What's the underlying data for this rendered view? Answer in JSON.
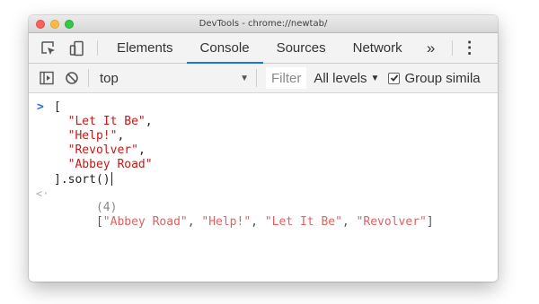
{
  "window": {
    "title": "DevTools - chrome://newtab/"
  },
  "tabs": [
    {
      "label": "Elements"
    },
    {
      "label": "Console",
      "active": true
    },
    {
      "label": "Sources"
    },
    {
      "label": "Network"
    }
  ],
  "tab_overflow": "»",
  "menu_glyph": "⋮",
  "console_toolbar": {
    "context": "top",
    "filter_placeholder": "Filter",
    "levels": "All levels",
    "group_similar_label": "Group simila",
    "group_similar_checked": true
  },
  "console": {
    "prompt": ">",
    "input_lines": [
      {
        "tokens": [
          {
            "t": "[",
            "k": "p"
          }
        ]
      },
      {
        "tokens": [
          {
            "t": "  ",
            "k": "p"
          },
          {
            "t": "\"Let It Be\"",
            "k": "s"
          },
          {
            "t": ",",
            "k": "p"
          }
        ]
      },
      {
        "tokens": [
          {
            "t": "  ",
            "k": "p"
          },
          {
            "t": "\"Help!\"",
            "k": "s"
          },
          {
            "t": ",",
            "k": "p"
          }
        ]
      },
      {
        "tokens": [
          {
            "t": "  ",
            "k": "p"
          },
          {
            "t": "\"Revolver\"",
            "k": "s"
          },
          {
            "t": ",",
            "k": "p"
          }
        ]
      },
      {
        "tokens": [
          {
            "t": "  ",
            "k": "p"
          },
          {
            "t": "\"Abbey Road\"",
            "k": "s"
          }
        ]
      },
      {
        "tokens": [
          {
            "t": "].sort()",
            "k": "p"
          }
        ]
      }
    ],
    "result_arrow": "<·",
    "result": {
      "count": "(4)",
      "open": "[",
      "items": [
        "\"Abbey Road\"",
        "\"Help!\"",
        "\"Let It Be\"",
        "\"Revolver\""
      ],
      "close": "]"
    }
  },
  "colors": {
    "active_tab_accent": "#1a73e8",
    "string": "#c41a16",
    "result_string": "#e06260",
    "prompt": "#1a73e8"
  },
  "icons": [
    "inspect-element-icon",
    "device-toolbar-icon",
    "show-sidebar-icon",
    "clear-console-icon",
    "dropdown-arrow-icon",
    "checkbox-checked-icon"
  ]
}
